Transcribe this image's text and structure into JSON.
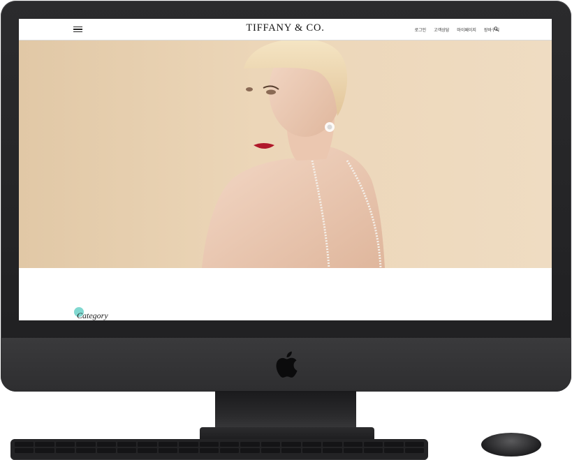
{
  "site": {
    "logo": "TIFFANY & CO.",
    "nav": [
      "로그인",
      "고객상담",
      "마이페이지",
      "장바구니"
    ],
    "section_title": "Category",
    "accent_color": "#81d8d0"
  },
  "icons": {
    "menu": "hamburger-menu-icon",
    "search": "search-icon",
    "apple": "apple-logo-icon"
  }
}
